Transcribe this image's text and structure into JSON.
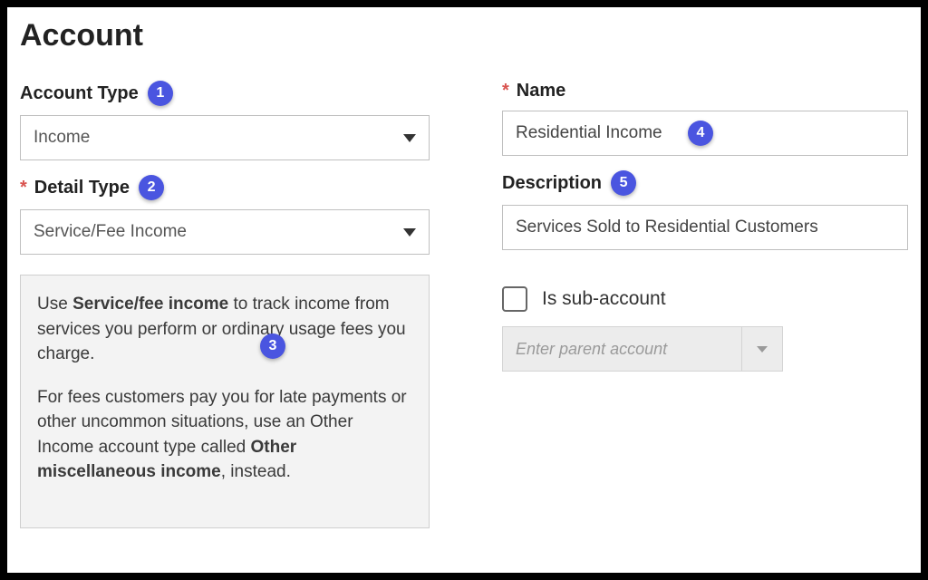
{
  "title": "Account",
  "left": {
    "account_type_label": "Account Type",
    "account_type_value": "Income",
    "detail_type_label": "Detail Type",
    "detail_type_value": "Service/Fee Income",
    "help_html_parts": {
      "p1_lead": "Use ",
      "p1_bold": "Service/fee income",
      "p1_tail": " to track income from services you perform or ordinary usage fees you charge.",
      "p2_lead": "For fees customers pay you for late payments or other uncommon situations, use an Other Income account type called ",
      "p2_bold": "Other miscellaneous income",
      "p2_tail": ", instead."
    }
  },
  "right": {
    "name_label": "Name",
    "name_value": "Residential Income",
    "description_label": "Description",
    "description_value": "Services Sold to Residential Customers",
    "sub_account_label": "Is sub-account",
    "parent_placeholder": "Enter parent account"
  },
  "badges": {
    "b1": "1",
    "b2": "2",
    "b3": "3",
    "b4": "4",
    "b5": "5"
  }
}
